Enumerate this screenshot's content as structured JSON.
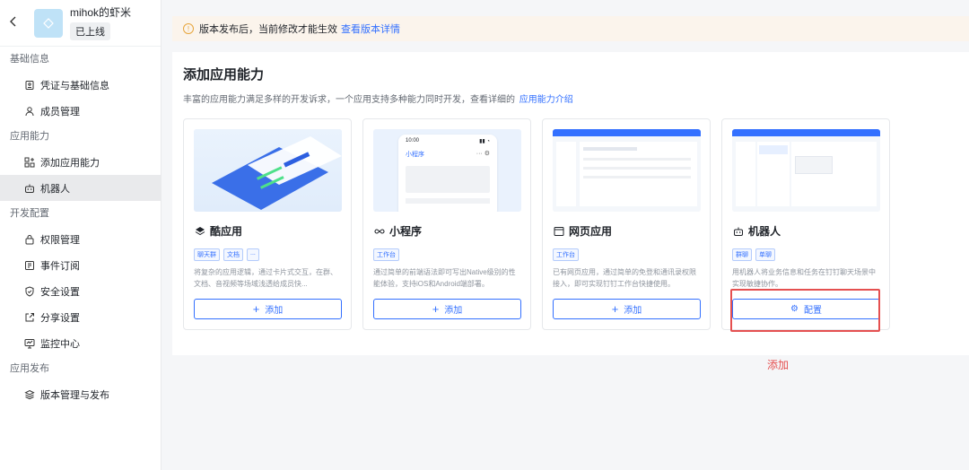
{
  "app": {
    "name": "mihok的虾米",
    "status": "已上线"
  },
  "sidebar": {
    "groups": [
      {
        "title": "基础信息",
        "items": [
          {
            "label": "凭证与基础信息",
            "icon": "credential-icon"
          },
          {
            "label": "成员管理",
            "icon": "member-icon"
          }
        ]
      },
      {
        "title": "应用能力",
        "items": [
          {
            "label": "添加应用能力",
            "icon": "add-capability-icon"
          },
          {
            "label": "机器人",
            "icon": "robot-icon",
            "active": true
          }
        ]
      },
      {
        "title": "开发配置",
        "items": [
          {
            "label": "权限管理",
            "icon": "lock-icon"
          },
          {
            "label": "事件订阅",
            "icon": "event-icon"
          },
          {
            "label": "安全设置",
            "icon": "shield-icon"
          },
          {
            "label": "分享设置",
            "icon": "share-icon"
          },
          {
            "label": "监控中心",
            "icon": "monitor-icon"
          }
        ]
      },
      {
        "title": "应用发布",
        "items": [
          {
            "label": "版本管理与发布",
            "icon": "layers-icon"
          }
        ]
      }
    ]
  },
  "notice": {
    "text": "版本发布后，当前修改才能生效",
    "link": "查看版本详情"
  },
  "panel": {
    "title": "添加应用能力",
    "desc": "丰富的应用能力满足多样的开发诉求，一个应用支持多种能力同时开发，查看详细的",
    "link": "应用能力介绍"
  },
  "cards": [
    {
      "title": "酷应用",
      "tags": [
        "聊天群",
        "文档",
        "..."
      ],
      "desc": "将复杂的应用逻辑，通过卡片式交互，在群、文档、音视频等场域浅透给成员快...",
      "button": "添加"
    },
    {
      "title": "小程序",
      "tags": [
        "工作台"
      ],
      "desc": "通过简单的前端语法即可写出Native级别的性能体验，支持iOS和Android端部署。",
      "button": "添加",
      "phone_time": "10:00",
      "phone_title": "小程序"
    },
    {
      "title": "网页应用",
      "tags": [
        "工作台"
      ],
      "desc": "已有网页应用，通过简单的免登和通讯录权限接入，即可实现钉钉工作台快捷使用。",
      "button": "添加"
    },
    {
      "title": "机器人",
      "tags": [
        "群聊",
        "单聊"
      ],
      "desc": "用机器人将业务信息和任务在钉钉聊天场景中实现敏捷协作。",
      "button": "配置"
    }
  ],
  "annotation": "添加",
  "colors": {
    "accent": "#3370ff",
    "highlight": "#e55050",
    "notice_bg": "#fbf4ec"
  }
}
